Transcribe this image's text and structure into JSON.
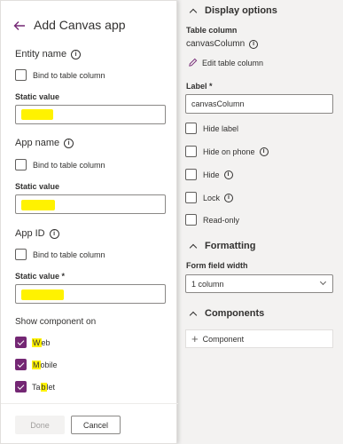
{
  "panel": {
    "title": "Add Canvas app",
    "sections": [
      {
        "title": "Entity name",
        "bind_label": "Bind to table column",
        "static_label": "Static value"
      },
      {
        "title": "App name",
        "bind_label": "Bind to table column",
        "static_label": "Static value"
      },
      {
        "title": "App ID",
        "bind_label": "Bind to table column",
        "static_label": "Static value *"
      }
    ],
    "show_on": {
      "title": "Show component on",
      "options": [
        {
          "label": "Web",
          "hl": "W",
          "rest": "eb",
          "checked": true
        },
        {
          "label": "Mobile",
          "hl": "M",
          "rest": "obile",
          "checked": true
        },
        {
          "label": "Tablet",
          "pre": "Ta",
          "hl": "b",
          "rest": "let",
          "checked": true
        }
      ]
    },
    "buttons": {
      "done": "Done",
      "cancel": "Cancel"
    }
  },
  "props": {
    "display_options": {
      "header": "Display options",
      "table_column_label": "Table column",
      "table_column_value": "canvasColumn",
      "edit_link": "Edit table column",
      "label_label": "Label *",
      "label_value": "canvasColumn",
      "checkboxes": [
        {
          "label": "Hide label",
          "info": false
        },
        {
          "label": "Hide on phone",
          "info": true
        },
        {
          "label": "Hide",
          "info": true
        },
        {
          "label": "Lock",
          "info": true
        },
        {
          "label": "Read-only",
          "info": false
        }
      ]
    },
    "formatting": {
      "header": "Formatting",
      "width_label": "Form field width",
      "width_value": "1 column"
    },
    "components": {
      "header": "Components",
      "button_label": "Component"
    }
  },
  "colors": {
    "accent": "#742774",
    "highlight": "#fff200"
  }
}
